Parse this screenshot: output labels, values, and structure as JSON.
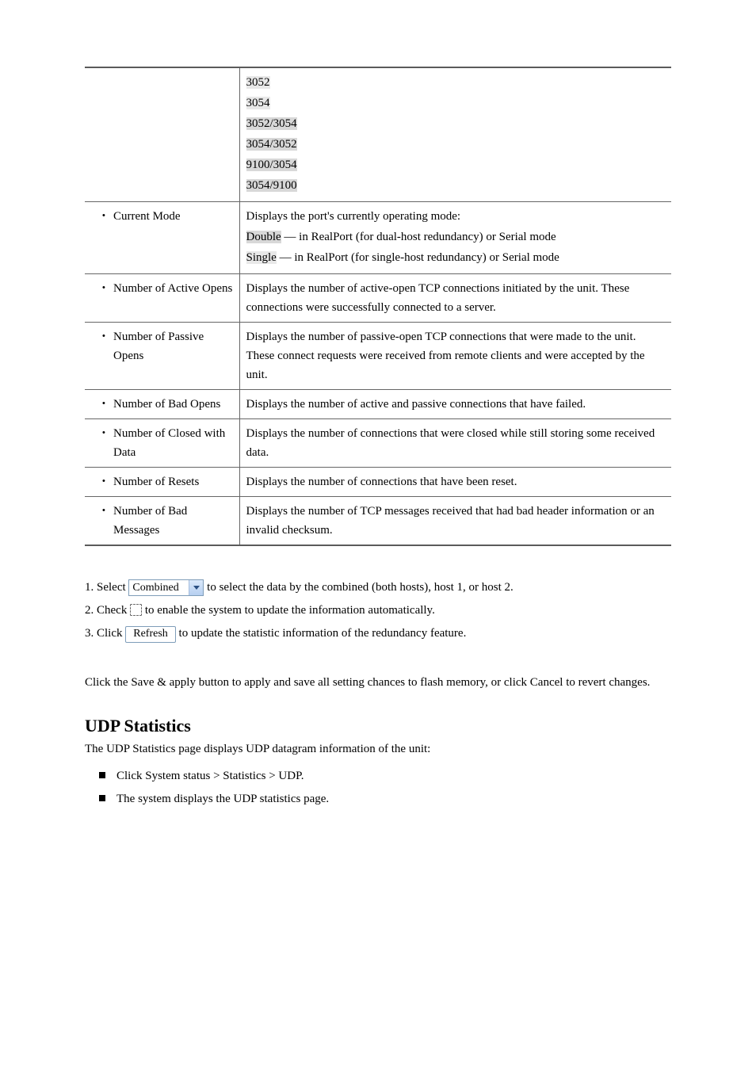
{
  "table": {
    "rows": [
      {
        "field": "",
        "desc_html": [
          {
            "hl": "light",
            "text": "3052"
          },
          {
            "hl": "light",
            "text": "3054"
          },
          {
            "hl": "dark",
            "text": "3052/3054"
          },
          {
            "hl": "dark",
            "text": "3054/3052"
          },
          {
            "hl": "dark",
            "text": "9100/3054"
          },
          {
            "hl": "dark",
            "text": "3054/9100"
          }
        ]
      },
      {
        "field": "Current Mode",
        "desc_intro": "Displays the port's currently operating mode:",
        "desc_opts": [
          {
            "hl": "dark",
            "label": "Double",
            "tail": " — in RealPort (for dual-host redundancy) or Serial mode"
          },
          {
            "hl": "light",
            "label": "Single",
            "tail": " — in RealPort (for single-host redundancy) or Serial mode"
          }
        ]
      },
      {
        "field": "Number of Active Opens",
        "desc": "Displays the number of active-open TCP connections initiated by the unit. These connections were successfully connected to a server."
      },
      {
        "field": "Number of Passive Opens",
        "desc": "Displays the number of passive-open TCP connections that were made to the unit. These connect requests were received from remote clients and were accepted by the unit."
      },
      {
        "field": "Number of Bad Opens",
        "desc": "Displays the number of active and passive connections that have failed."
      },
      {
        "field": "Number of Closed with Data",
        "desc": "Displays the number of connections that were closed while still storing some received data."
      },
      {
        "field": "Number of Resets",
        "desc": "Displays the number of connections that have been reset."
      },
      {
        "field": "Number of Bad Messages",
        "desc": "Displays the number of TCP messages received that had bad header information or an invalid checksum."
      }
    ]
  },
  "controls": {
    "dropdown_label_pre": "1. Select ",
    "dropdown_value": "Combined",
    "dropdown_label_post": " to select the data by the combined (both hosts), host 1, or host 2.",
    "auto_refresh_pre": "2. Check ",
    "auto_refresh_post": " to enable the system to update the information automatically.",
    "refresh_pre": "3. Click ",
    "refresh_label": "Refresh",
    "refresh_post": " to update the statistic information of the redundancy feature."
  },
  "para_save": "Click the Save & apply button to apply and save all setting chances to flash memory, or click Cancel to revert changes.",
  "heading": "UDP Statistics",
  "heading_para": "The UDP Statistics page displays UDP datagram information of the unit:",
  "bullets": [
    "Click System status > Statistics > UDP.",
    "The system displays the UDP statistics page."
  ]
}
